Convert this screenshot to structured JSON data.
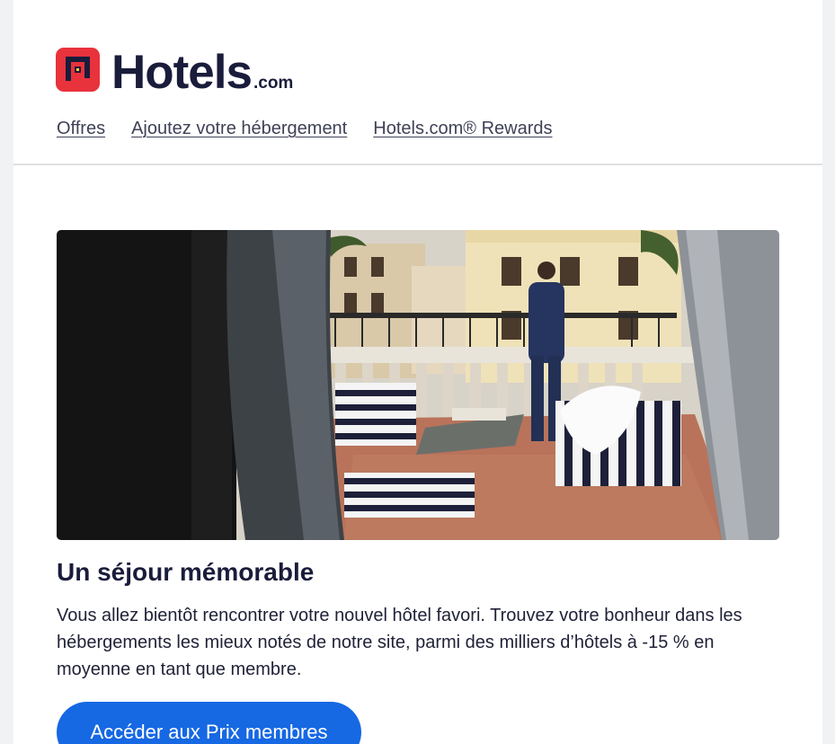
{
  "brand": {
    "name": "Hotels",
    "suffix": ".com",
    "color": "#e8323c",
    "icon": "hotels-logo-icon"
  },
  "nav": {
    "items": [
      {
        "label": "Offres"
      },
      {
        "label": "Ajoutez votre hébergement"
      },
      {
        "label": "Hotels.com® Rewards"
      }
    ]
  },
  "hero": {
    "title": "Un séjour mémorable",
    "body": "Vous allez bientôt rencontrer votre nouvel hôtel favori. Trouvez votre bonheur dans les hébergements les mieux notés de notre site, parmi des milliers d’hôtels à -15 % en moyenne en tant que membre.",
    "cta_label": "Accéder aux Prix membres",
    "cta_color": "#1668e3"
  }
}
